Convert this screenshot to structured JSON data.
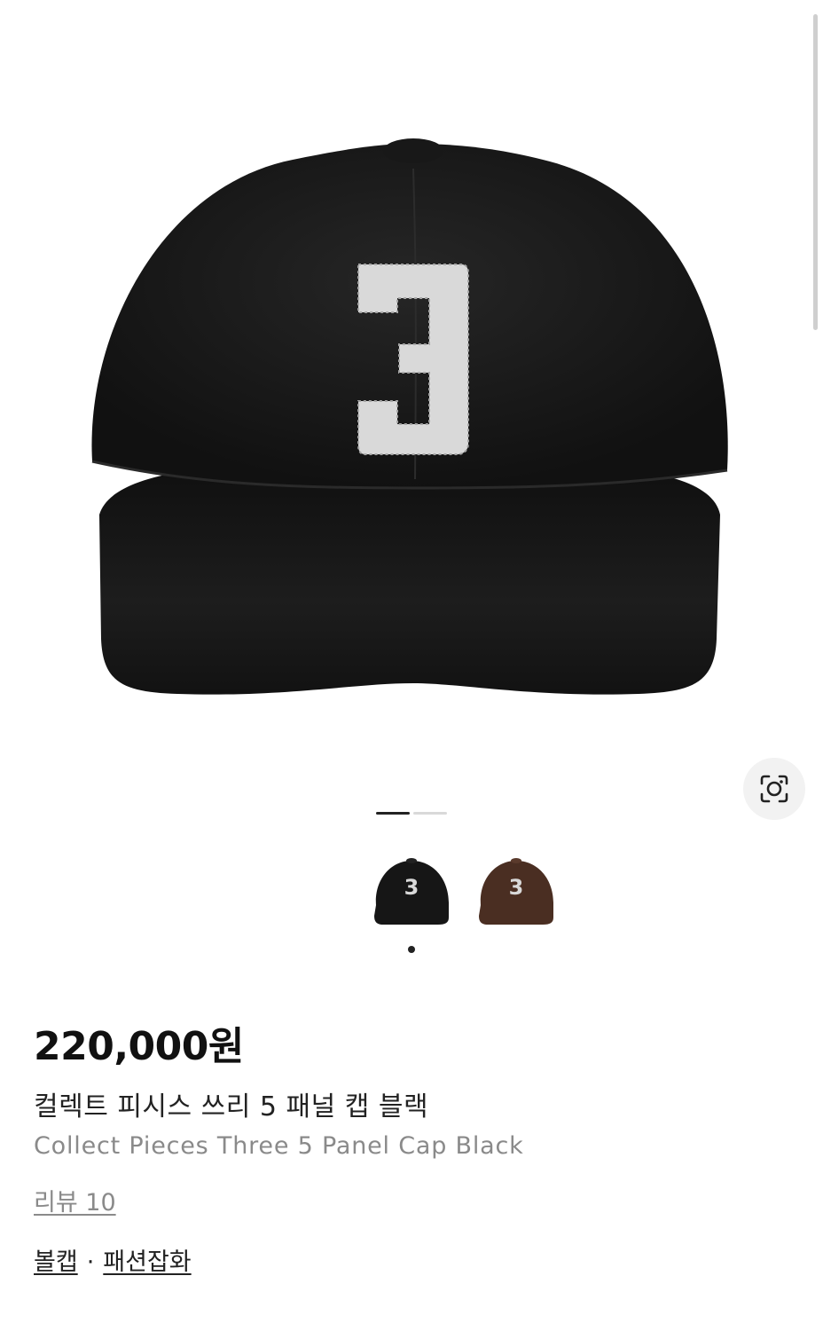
{
  "product": {
    "image_alt": "Black 5 panel cap with white number 3 patch",
    "patch_number": "3",
    "price": "220,000원",
    "name_ko": "컬렉트 피시스 쓰리 5 패널 캡 블랙",
    "name_en": "Collect Pieces Three 5 Panel Cap Black",
    "review_label": "리뷰 10",
    "categories": [
      "볼캡",
      "패션잡화"
    ],
    "category_separator": "·"
  },
  "gallery": {
    "page_count": 2,
    "active_page": 1
  },
  "swatches": [
    {
      "name": "black",
      "color": "#161616",
      "patch": "3",
      "selected": true
    },
    {
      "name": "brown",
      "color": "#4a2e22",
      "patch": "3",
      "selected": false
    }
  ],
  "colors": {
    "cap": "#1b1b1b",
    "patch": "#d9d9d9",
    "text": "#222222",
    "muted": "#8a8a8a"
  },
  "icons": {
    "lens": "visual-search-icon"
  }
}
